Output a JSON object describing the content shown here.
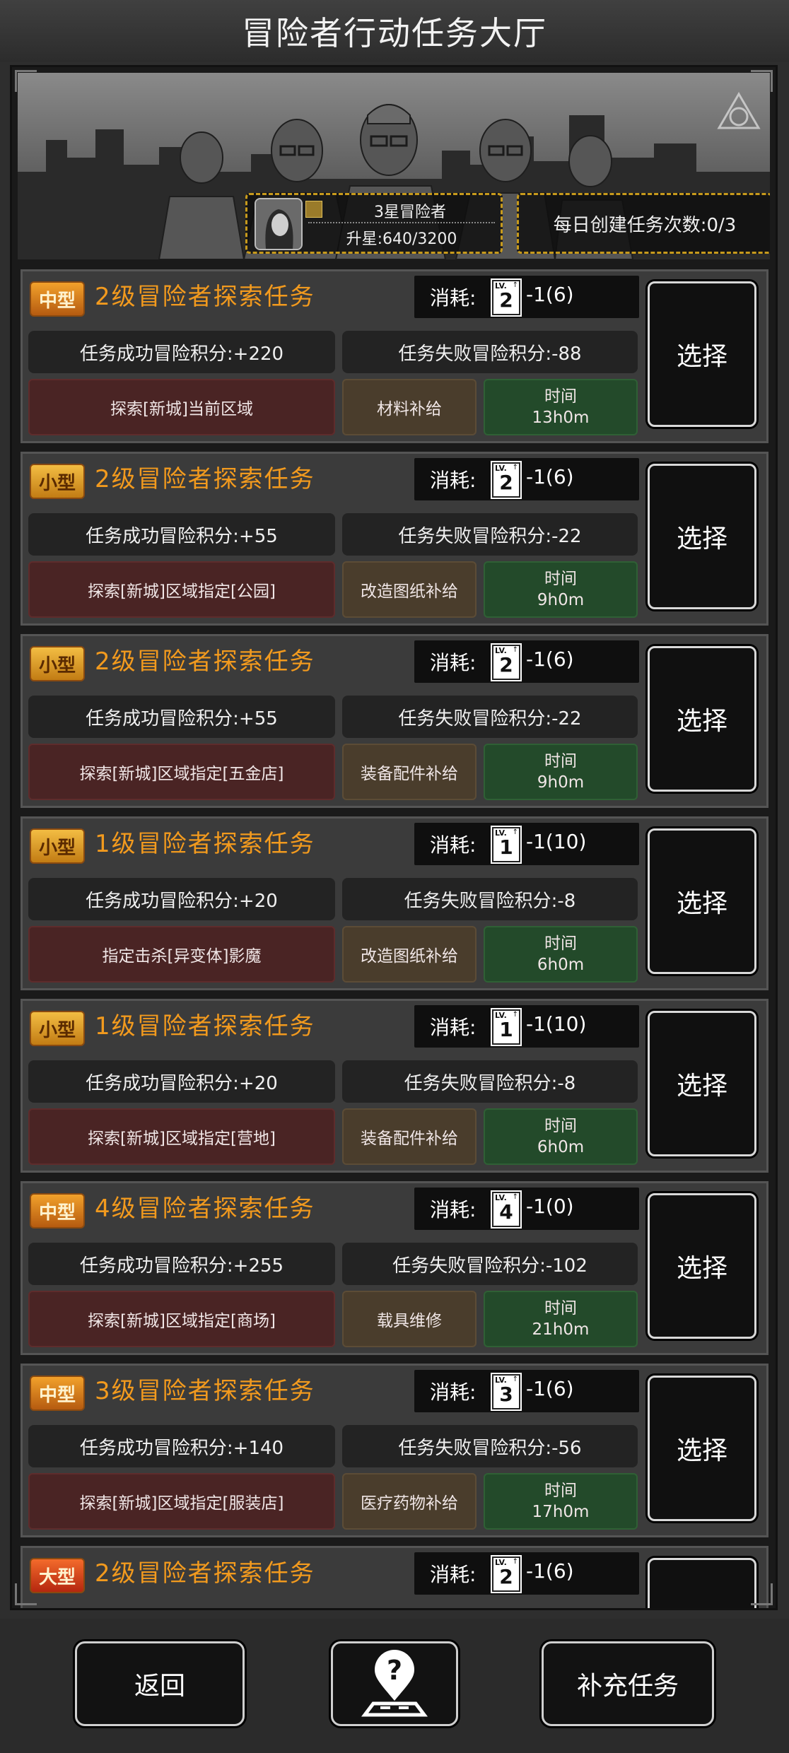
{
  "title": "冒险者行动任务大厅",
  "rank": {
    "name": "3星冒险者",
    "progress": "升星:640/3200"
  },
  "daily": "每日创建任务次数:0/3",
  "cost_label": "消耗:",
  "select_label": "选择",
  "missions": [
    {
      "size": "中型",
      "title": "2级冒险者探索任务",
      "lv": "2",
      "cost": "-1(6)",
      "success": "任务成功冒险积分:+220",
      "fail": "任务失败冒险积分:-88",
      "location": "探索[新城]当前区域",
      "reward": "材料补给",
      "time_label": "时间",
      "time": "13h0m"
    },
    {
      "size": "小型",
      "title": "2级冒险者探索任务",
      "lv": "2",
      "cost": "-1(6)",
      "success": "任务成功冒险积分:+55",
      "fail": "任务失败冒险积分:-22",
      "location": "探索[新城]区域指定[公园]",
      "reward": "改造图纸补给",
      "time_label": "时间",
      "time": "9h0m"
    },
    {
      "size": "小型",
      "title": "2级冒险者探索任务",
      "lv": "2",
      "cost": "-1(6)",
      "success": "任务成功冒险积分:+55",
      "fail": "任务失败冒险积分:-22",
      "location": "探索[新城]区域指定[五金店]",
      "reward": "装备配件补给",
      "time_label": "时间",
      "time": "9h0m"
    },
    {
      "size": "小型",
      "title": "1级冒险者探索任务",
      "lv": "1",
      "cost": "-1(10)",
      "success": "任务成功冒险积分:+20",
      "fail": "任务失败冒险积分:-8",
      "location": "指定击杀[异变体]影魔",
      "reward": "改造图纸补给",
      "time_label": "时间",
      "time": "6h0m"
    },
    {
      "size": "小型",
      "title": "1级冒险者探索任务",
      "lv": "1",
      "cost": "-1(10)",
      "success": "任务成功冒险积分:+20",
      "fail": "任务失败冒险积分:-8",
      "location": "探索[新城]区域指定[营地]",
      "reward": "装备配件补给",
      "time_label": "时间",
      "time": "6h0m"
    },
    {
      "size": "中型",
      "title": "4级冒险者探索任务",
      "lv": "4",
      "cost": "-1(0)",
      "success": "任务成功冒险积分:+255",
      "fail": "任务失败冒险积分:-102",
      "location": "探索[新城]区域指定[商场]",
      "reward": "载具维修",
      "time_label": "时间",
      "time": "21h0m"
    },
    {
      "size": "中型",
      "title": "3级冒险者探索任务",
      "lv": "3",
      "cost": "-1(6)",
      "success": "任务成功冒险积分:+140",
      "fail": "任务失败冒险积分:-56",
      "location": "探索[新城]区域指定[服装店]",
      "reward": "医疗药物补给",
      "time_label": "时间",
      "time": "17h0m"
    },
    {
      "size": "大型",
      "title": "2级冒险者探索任务",
      "lv": "2",
      "cost": "-1(6)"
    }
  ],
  "buttons": {
    "back": "返回",
    "help_icon": "help-map-pin-icon",
    "refill": "补充任务"
  }
}
